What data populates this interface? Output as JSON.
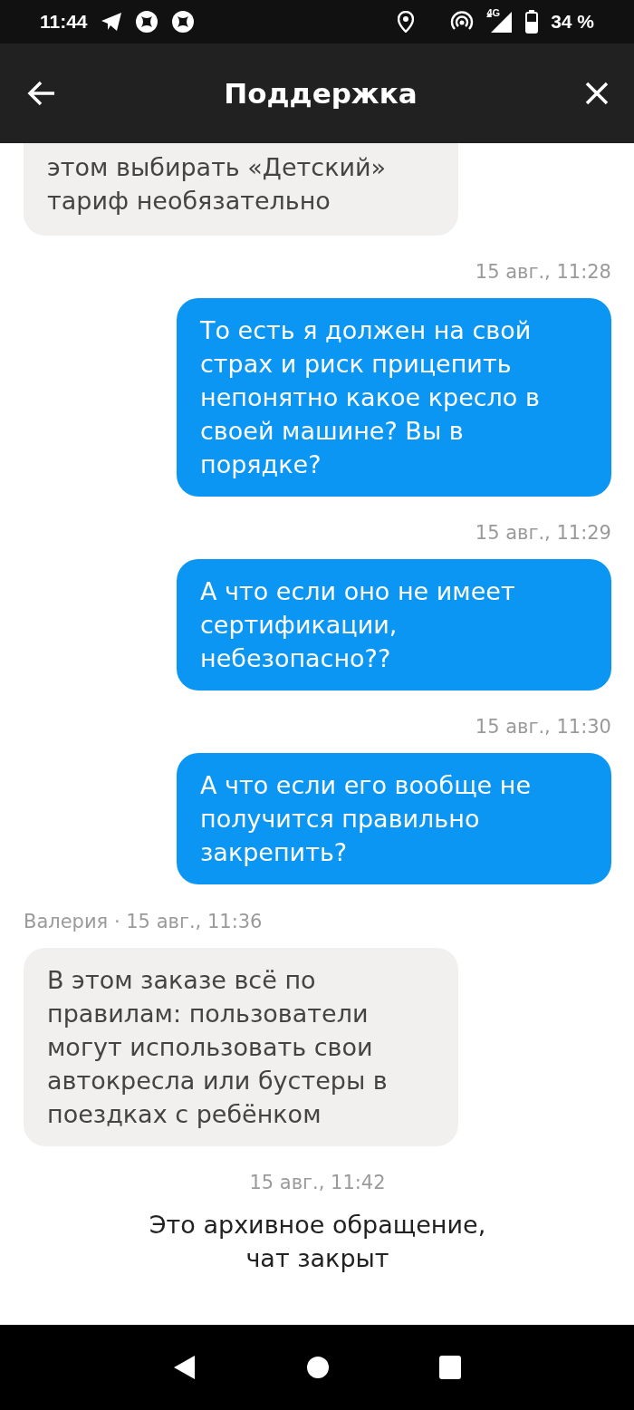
{
  "status_bar": {
    "time": "11:44",
    "network": "4G",
    "battery": "34 %"
  },
  "header": {
    "title": "Поддержка"
  },
  "entries": [
    {
      "kind": "bubble-in",
      "text": "этом выбирать «Детский»\nтариф необязательно",
      "cut": true
    },
    {
      "kind": "meta-right",
      "text": "15 авг., 11:28"
    },
    {
      "kind": "bubble-out",
      "text": "То есть я должен на свой\nстрах и риск прицепить\nнепонятно какое кресло в\nсвоей машине? Вы в\nпорядке?"
    },
    {
      "kind": "meta-right",
      "text": "15 авг., 11:29"
    },
    {
      "kind": "bubble-out",
      "text": "А что если оно не имеет\nсертификации,\nнебезопасно??"
    },
    {
      "kind": "meta-right",
      "text": "15 авг., 11:30"
    },
    {
      "kind": "bubble-out",
      "text": "А что если его вообще не\nполучится правильно\nзакрепить?"
    },
    {
      "kind": "meta-left",
      "text": "Валерия · 15 авг., 11:36"
    },
    {
      "kind": "bubble-in",
      "text": "В этом заказе всё по\nправилам: пользователи\nмогут использовать свои\nавтокресла или бустеры в\nпоездках с ребёнком",
      "cut": false
    },
    {
      "kind": "meta-center",
      "text": "15 авг., 11:42"
    },
    {
      "kind": "notice",
      "text": "Это архивное обращение,\nчат закрыт"
    }
  ]
}
